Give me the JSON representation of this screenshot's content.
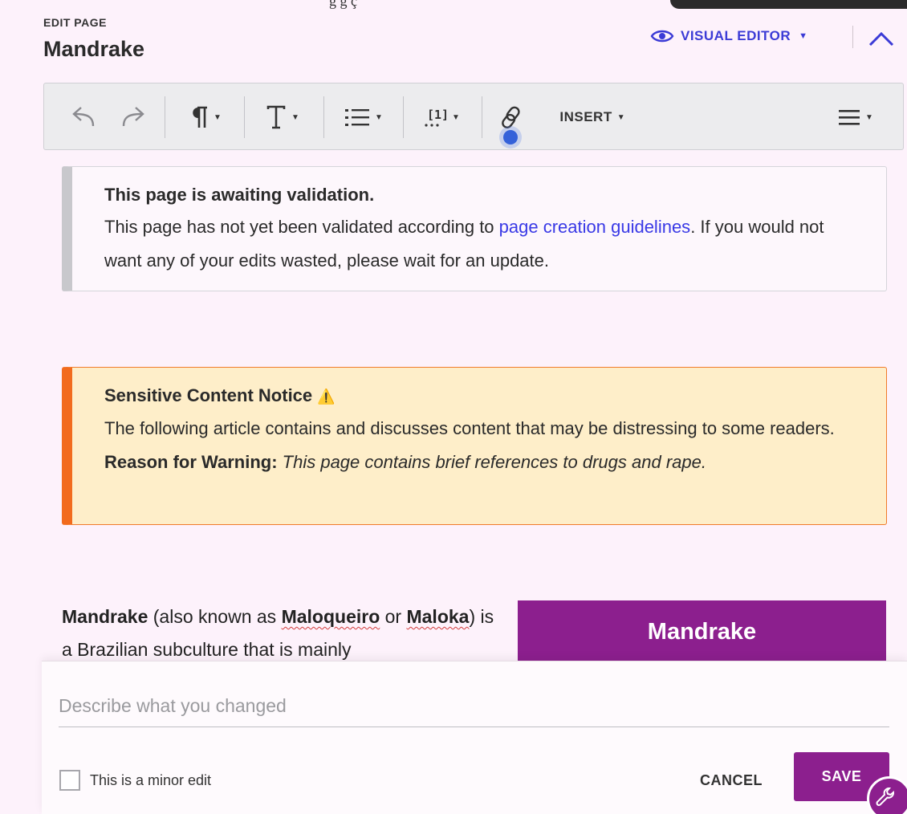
{
  "header": {
    "edit_label": "EDIT PAGE",
    "page_title": "Mandrake",
    "visual_editor_label": "VISUAL EDITOR",
    "clipped_top_text": "g      g     ç"
  },
  "toolbar": {
    "insert_label": "INSERT",
    "buttons": [
      "undo-icon",
      "redo-icon",
      "paragraph-format-icon",
      "text-style-icon",
      "list-icon",
      "cite-icon",
      "link-icon",
      "insert-menu",
      "page-options-icon"
    ]
  },
  "notices": {
    "validation": {
      "title": "This page is awaiting validation.",
      "text_before": "This page has not yet been validated according to ",
      "link": "page creation guidelines",
      "text_after": ". If you would not want any of your edits wasted, please wait for an update."
    },
    "sensitive": {
      "title": "Sensitive Content Notice",
      "warning_glyph": "⚠️",
      "body": "The following article contains and discusses content that may be distressing to some readers.",
      "reason_label": "Reason for Warning:",
      "reason_text": "This page contains brief references to drugs and rape."
    }
  },
  "article": {
    "subject": "Mandrake",
    "t1": " (also known as ",
    "alias1": "Maloqueiro",
    "t2": " or ",
    "alias2": "Maloka",
    "t3": ") is a Brazilian subculture that is mainly",
    "infobox_title": "Mandrake"
  },
  "save_panel": {
    "summary_placeholder": "Describe what you changed",
    "summary_value": "",
    "minor_edit_label": "This is a minor edit",
    "minor_edit_checked": false,
    "cancel_label": "CANCEL",
    "save_label": "SAVE"
  },
  "colors": {
    "accent": "#8c1f8e",
    "link": "#3939e6",
    "warning_border": "#f26b1d",
    "warning_bg": "#feeec9",
    "page_bg": "#fdf2fb"
  }
}
